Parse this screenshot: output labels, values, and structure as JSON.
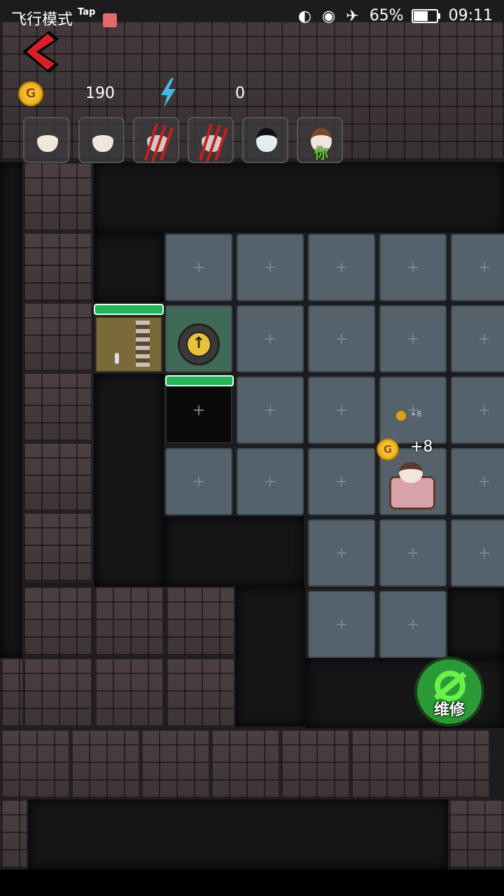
{
  "status_bar": {
    "mode_label": "飞行模式",
    "tap_label": "Tap",
    "battery": "65%",
    "time": "09:11"
  },
  "hud": {
    "gold": "190",
    "energy": "0",
    "coin_letter": "G"
  },
  "portraits": [
    {
      "name": "girl-1",
      "state": "alive"
    },
    {
      "name": "girl-2",
      "state": "alive"
    },
    {
      "name": "ghost-1",
      "state": "attacked"
    },
    {
      "name": "ghost-2",
      "state": "attacked"
    },
    {
      "name": "boy",
      "state": "alive"
    },
    {
      "name": "you",
      "state": "player",
      "label": "你"
    }
  ],
  "world": {
    "bed_gain_large": "+8",
    "bed_gain_small": "+8"
  },
  "repair_button": {
    "label": "维修",
    "color": "#2a9a36"
  },
  "colors": {
    "hp_bar": "#24b35a",
    "floor": "#55626c"
  }
}
